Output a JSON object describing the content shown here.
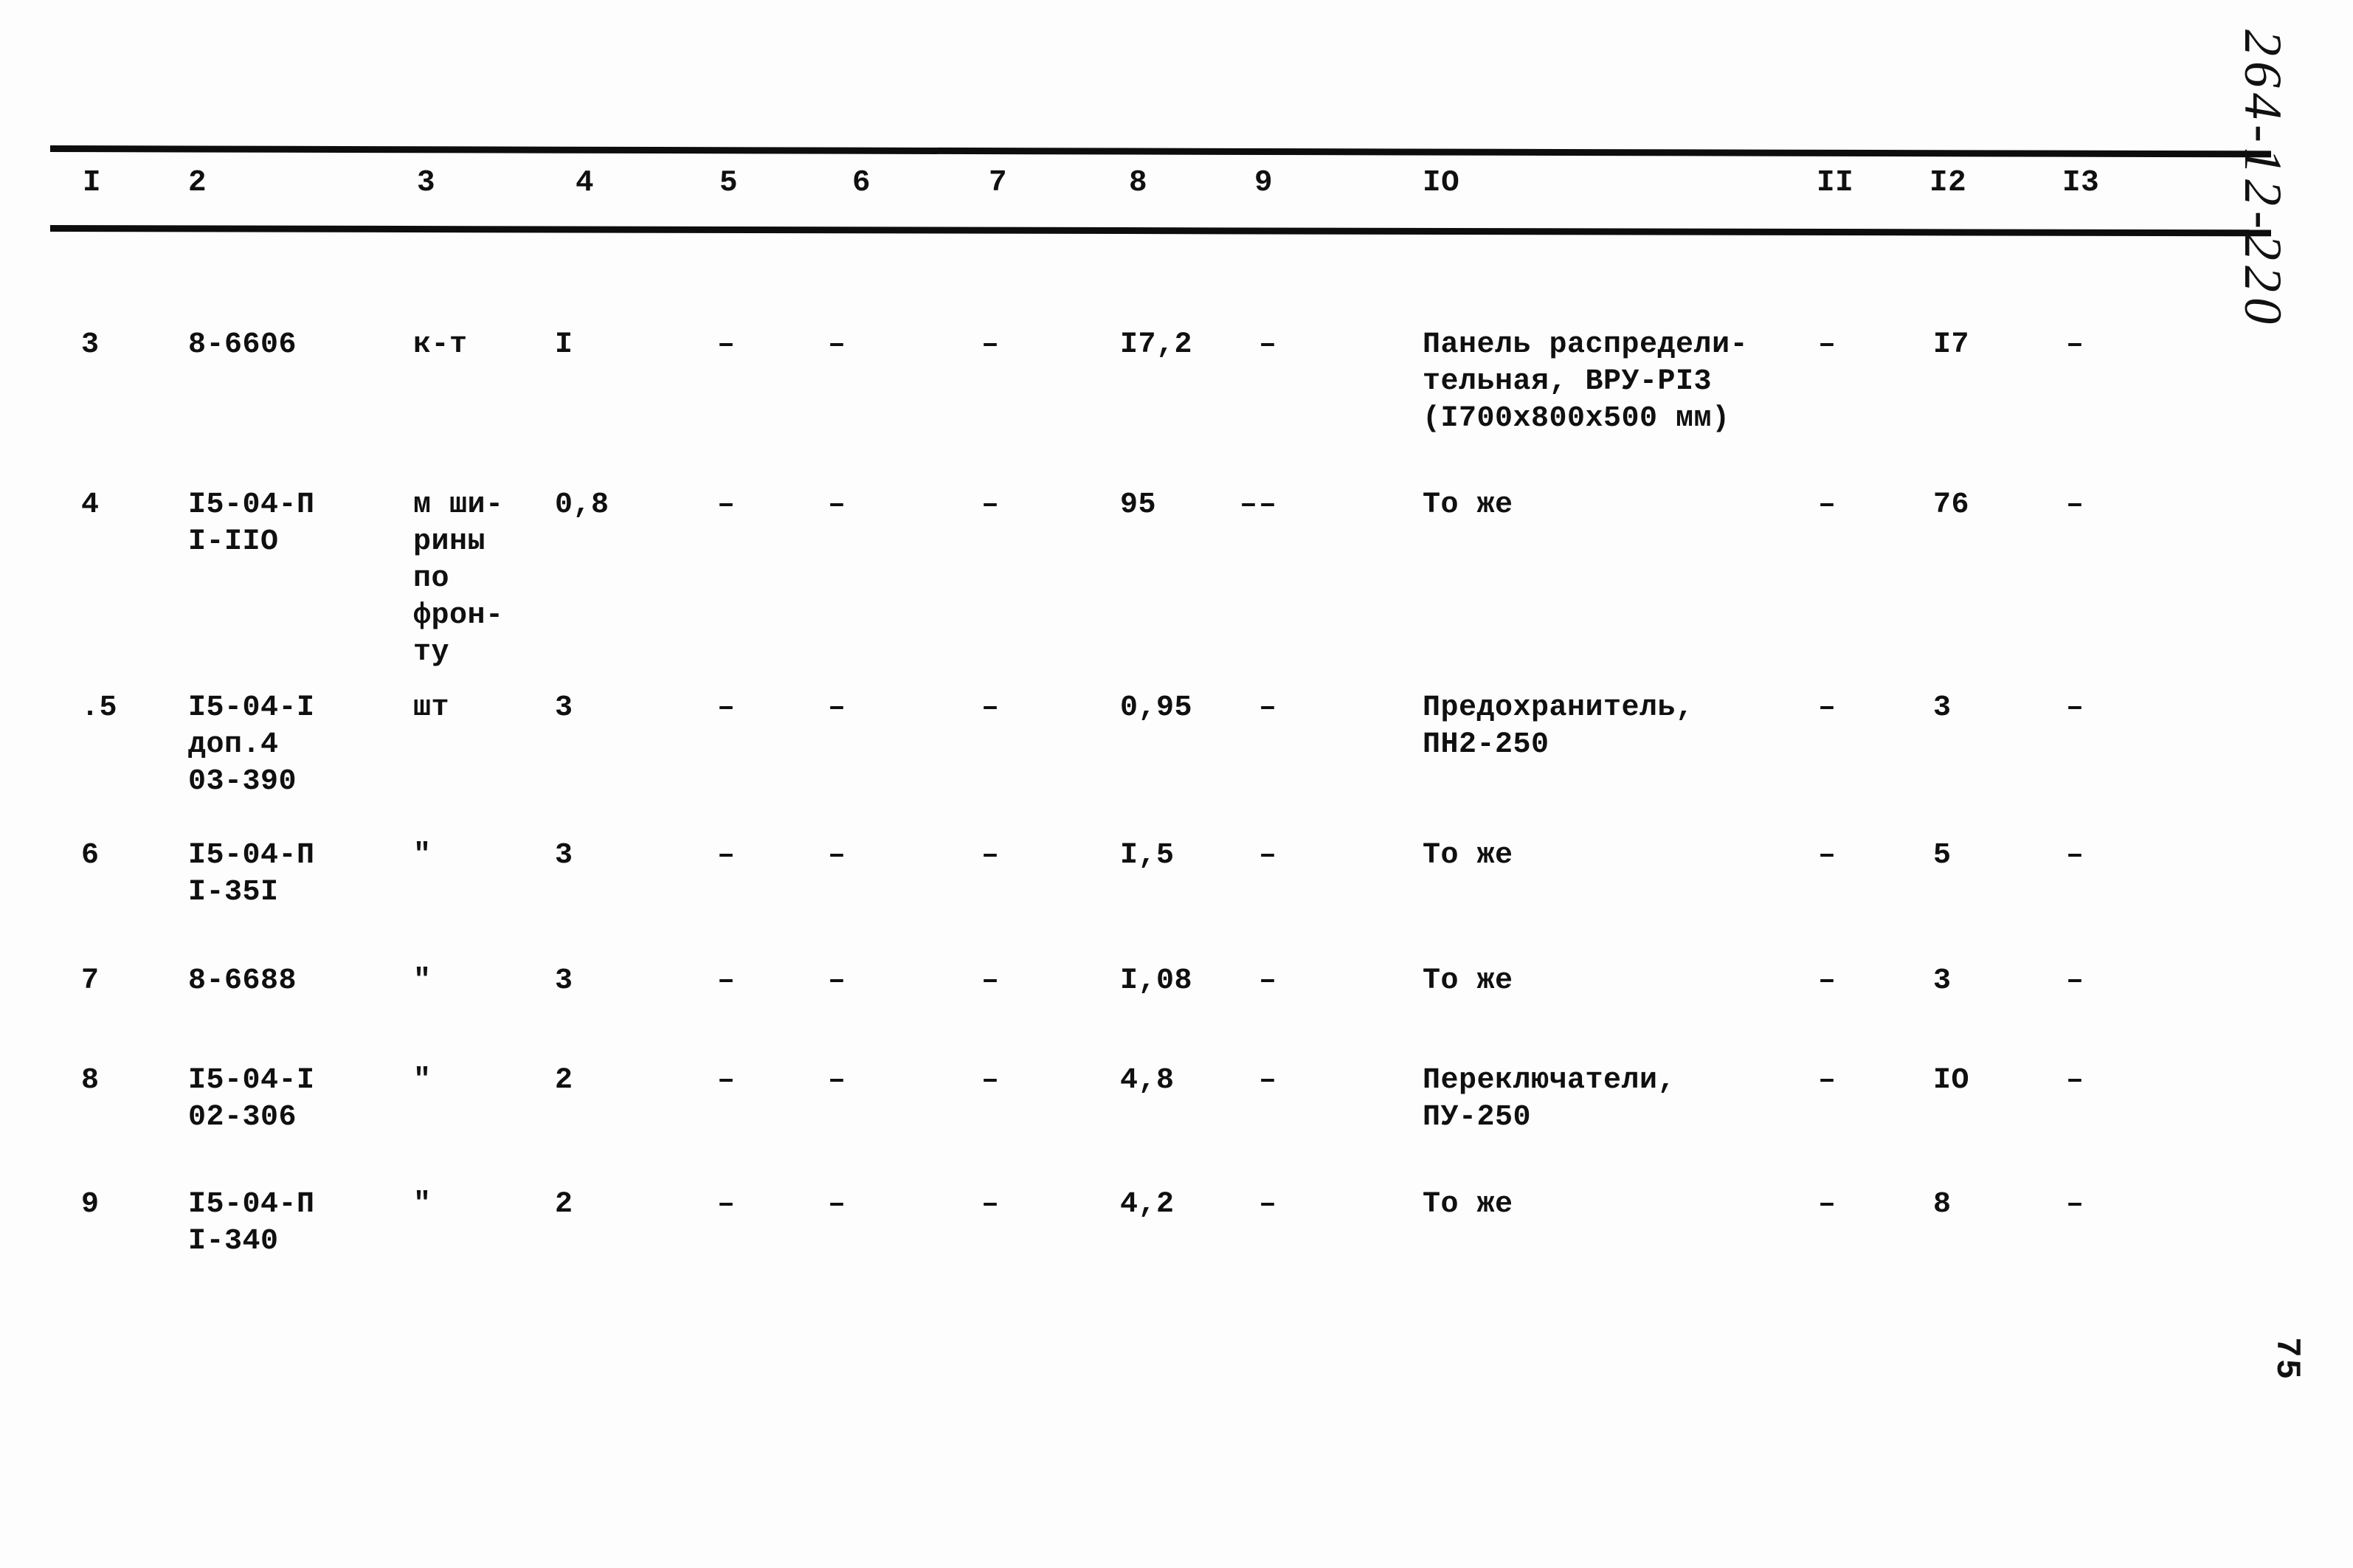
{
  "document": {
    "marginalia_handwritten": "264-12-220",
    "page_number": "75"
  },
  "table": {
    "column_headers": [
      "I",
      "2",
      "3",
      "4",
      "5",
      "6",
      "7",
      "8",
      "9",
      "IO",
      "II",
      "I2",
      "I3"
    ],
    "rows": [
      {
        "c1": "3",
        "c2": "8-6606",
        "c3": "к-т",
        "c4": "I",
        "c5": "–",
        "c6": "–",
        "c7": "–",
        "c8": "I7,2",
        "c8b": "",
        "c9": "–",
        "c10": "Панель распредели-\nтельная, ВРУ-РI3\n(I700x800x500 мм)",
        "c11": "–",
        "c12": "I7",
        "c13": "–"
      },
      {
        "c1": "4",
        "c2": "I5-04-П\nI-IIO",
        "c3": "м ши-\nрины\nпо\nфрон-\nту",
        "c4": "0,8",
        "c5": "–",
        "c6": "–",
        "c7": "–",
        "c8": "95",
        "c8b": "–",
        "c9": "–",
        "c10": "То же",
        "c11": "–",
        "c12": "76",
        "c13": "–"
      },
      {
        "c1": ".5",
        "c2": "I5-04-I\nдоп.4\n03-390",
        "c3": "шт",
        "c4": "3",
        "c5": "–",
        "c6": "–",
        "c7": "–",
        "c8": "0,95",
        "c8b": "",
        "c9": "–",
        "c10": "Предохранитель,\nПН2-250",
        "c11": "–",
        "c12": "3",
        "c13": "–"
      },
      {
        "c1": "6",
        "c2": "I5-04-П\nI-35I",
        "c3": "\"",
        "c4": "3",
        "c5": "–",
        "c6": "–",
        "c7": "–",
        "c8": "I,5",
        "c8b": "",
        "c9": "–",
        "c10": "То же",
        "c11": "–",
        "c12": "5",
        "c13": "–"
      },
      {
        "c1": "7",
        "c2": "8-6688",
        "c3": "\"",
        "c4": "3",
        "c5": "–",
        "c6": "–",
        "c7": "–",
        "c8": "I,08",
        "c8b": "",
        "c9": "–",
        "c10": "То же",
        "c11": "–",
        "c12": "3",
        "c13": "–"
      },
      {
        "c1": "8",
        "c2": "I5-04-I\n02-306",
        "c3": "\"",
        "c4": "2",
        "c5": "–",
        "c6": "–",
        "c7": "–",
        "c8": "4,8",
        "c8b": "",
        "c9": "–",
        "c10": "Переключатели,\nПУ-250",
        "c11": "–",
        "c12": "IO",
        "c13": "–"
      },
      {
        "c1": "9",
        "c2": "I5-04-П\nI-340",
        "c3": "\"",
        "c4": "2",
        "c5": "–",
        "c6": "–",
        "c7": "–",
        "c8": "4,2",
        "c8b": "",
        "c9": "–",
        "c10": "То же",
        "c11": "–",
        "c12": "8",
        "c13": "–"
      }
    ]
  }
}
